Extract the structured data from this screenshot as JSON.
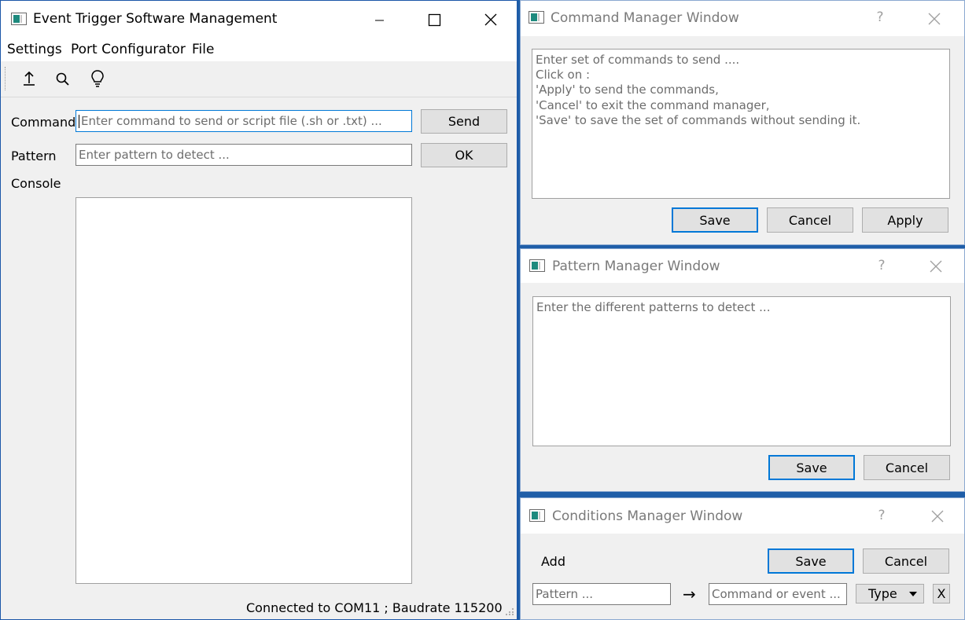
{
  "main_window": {
    "title": "Event Trigger Software Management",
    "menu": [
      "Settings",
      "Port Configurator",
      "File"
    ],
    "toolbar_icons": [
      "upload-icon",
      "search-icon",
      "lightbulb-icon"
    ],
    "command_label": "Command",
    "command_placeholder": "Enter command to send or script file (.sh or .txt) ...",
    "send_button": "Send",
    "pattern_label": "Pattern",
    "pattern_placeholder": "Enter pattern to detect ...",
    "ok_button": "OK",
    "console_label": "Console",
    "status_text": "Connected to COM11 ; Baudrate 115200"
  },
  "command_manager": {
    "title": "Command Manager Window",
    "help": "?",
    "placeholder": "Enter set of commands to send ....\nClick on :\n'Apply' to send the commands,\n'Cancel' to exit the command manager,\n'Save' to save the set of commands without sending it.",
    "save_button": "Save",
    "cancel_button": "Cancel",
    "apply_button": "Apply"
  },
  "pattern_manager": {
    "title": "Pattern Manager Window",
    "help": "?",
    "placeholder": "Enter the different patterns to detect ...",
    "save_button": "Save",
    "cancel_button": "Cancel"
  },
  "conditions_manager": {
    "title": "Conditions Manager Window",
    "help": "?",
    "add_label": "Add",
    "save_button": "Save",
    "cancel_button": "Cancel",
    "pattern_placeholder": "Pattern ...",
    "arrow": "→",
    "command_placeholder": "Command or event ...",
    "type_select": "Type",
    "remove_button": "X"
  },
  "colors": {
    "accent": "#0078d7",
    "desktop": "#1f5ea8",
    "window_bg": "#f0f0f0"
  }
}
